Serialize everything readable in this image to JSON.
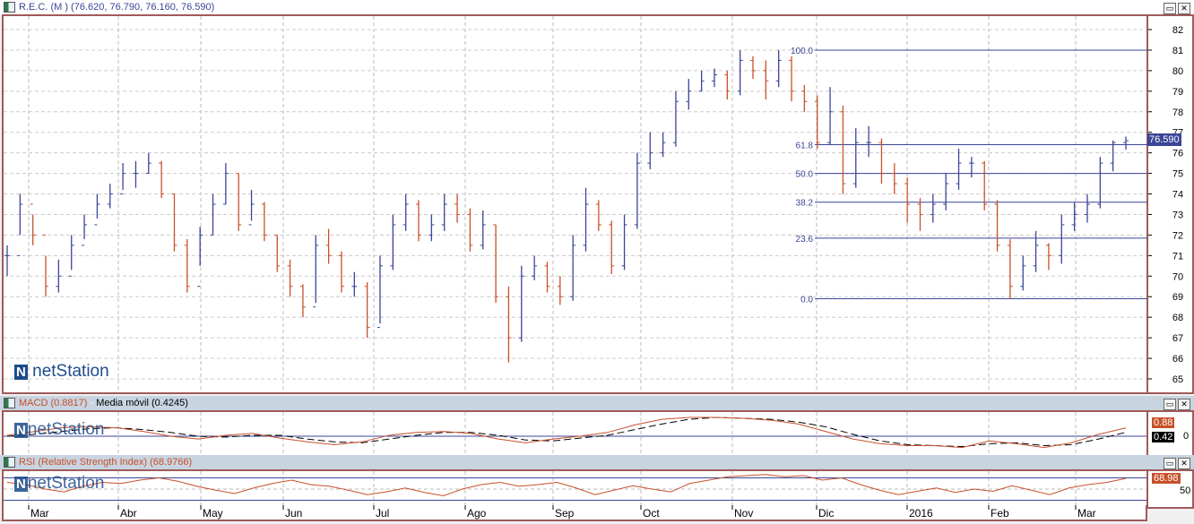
{
  "main": {
    "title": "R.E.C. (M ) (76.620, 76.790, 76.160, 76.590)",
    "last_price_label": "76.590",
    "watermark": "netStation"
  },
  "macd": {
    "title": "MACD (0.8817)",
    "sep": " - ",
    "ma_title": "Media móvil (0.4245)",
    "macd_badge": "0.88",
    "signal_badge": "0.42",
    "zero_label": "0"
  },
  "rsi": {
    "title": "RSI (Relative Strength Index) (68.9766)",
    "badge": "68.98",
    "mid_label": "50"
  },
  "colors": {
    "up": "#3a4596",
    "down": "#c8502a",
    "fib": "#3a4596",
    "frame": "#a05a5a"
  },
  "chart_data": {
    "type": "ohlc",
    "y_ticks": [
      82,
      81,
      80,
      79,
      78,
      77,
      76,
      75,
      74,
      73,
      72,
      71,
      70,
      69,
      68,
      67,
      66,
      65
    ],
    "ylim": [
      64.6,
      82.5
    ],
    "x_labels": [
      "Mar",
      "Abr",
      "May",
      "Jun",
      "Jul",
      "Ago",
      "Sep",
      "Oct",
      "Nov",
      "Dic",
      "2016",
      "Feb",
      "Mar"
    ],
    "fibonacci": [
      {
        "label": "100.0",
        "price": 81.0
      },
      {
        "label": "61.8",
        "price": 76.4
      },
      {
        "label": "50.0",
        "price": 75.0
      },
      {
        "label": "38.2",
        "price": 73.6
      },
      {
        "label": "23.6",
        "price": 71.85
      },
      {
        "label": "0.0",
        "price": 68.9
      }
    ],
    "bars_hlc": [
      [
        71.5,
        70,
        71
      ],
      [
        74,
        72,
        73.5
      ],
      [
        73,
        71.5,
        72
      ],
      [
        71,
        69,
        69.5
      ],
      [
        70.8,
        69.2,
        70
      ],
      [
        72,
        70.3,
        71.5
      ],
      [
        73,
        71.8,
        72.5
      ],
      [
        74,
        72.8,
        73.5
      ],
      [
        74.5,
        73.3,
        74
      ],
      [
        75.5,
        74.2,
        75
      ],
      [
        75.6,
        74.3,
        75
      ],
      [
        76,
        75,
        75.5
      ],
      [
        75.6,
        73.8,
        74
      ],
      [
        74,
        71.2,
        71.5
      ],
      [
        71.8,
        69.2,
        69.5
      ],
      [
        72.4,
        70.5,
        72
      ],
      [
        74,
        72,
        73.5
      ],
      [
        75.5,
        73.5,
        75
      ],
      [
        75,
        72.2,
        72.5
      ],
      [
        74.2,
        72.7,
        73.5
      ],
      [
        73.6,
        71.7,
        72
      ],
      [
        72,
        70.2,
        70.5
      ],
      [
        70.8,
        69,
        69.5
      ],
      [
        69.6,
        68,
        68.5
      ],
      [
        72,
        68.7,
        71.5
      ],
      [
        72.3,
        70.6,
        71
      ],
      [
        71.2,
        69.2,
        69.5
      ],
      [
        70.2,
        69,
        69.5
      ],
      [
        69.7,
        67,
        67.5
      ],
      [
        71,
        67.7,
        70.5
      ],
      [
        73,
        70.3,
        72.5
      ],
      [
        74,
        72.2,
        73.5
      ],
      [
        73.7,
        71.7,
        72
      ],
      [
        73,
        71.7,
        72.5
      ],
      [
        74,
        72.2,
        73.5
      ],
      [
        74,
        72.6,
        73
      ],
      [
        73.3,
        71.2,
        71.5
      ],
      [
        73.2,
        71.3,
        72.5
      ],
      [
        72.5,
        68.7,
        69
      ],
      [
        69.5,
        65.8,
        67
      ],
      [
        70.5,
        66.8,
        70
      ],
      [
        71,
        69.8,
        70.5
      ],
      [
        70.7,
        69.2,
        69.5
      ],
      [
        70,
        68.6,
        69
      ],
      [
        72,
        68.8,
        71.5
      ],
      [
        74.3,
        71.2,
        73.5
      ],
      [
        73.7,
        72.2,
        72.5
      ],
      [
        72.7,
        70.1,
        70.5
      ],
      [
        73,
        70.3,
        72.5
      ],
      [
        76,
        72.3,
        75.5
      ],
      [
        77,
        75.2,
        76
      ],
      [
        77,
        75.8,
        76.5
      ],
      [
        79,
        76.3,
        78.5
      ],
      [
        79.6,
        78.1,
        79
      ],
      [
        80,
        79,
        79.5
      ],
      [
        80.1,
        79.2,
        79.8
      ],
      [
        80,
        78.6,
        79
      ],
      [
        81,
        78.8,
        80.5
      ],
      [
        80.7,
        79.6,
        80
      ],
      [
        80.5,
        78.6,
        79.5
      ],
      [
        81,
        79.2,
        80.5
      ],
      [
        80.7,
        78.5,
        79
      ],
      [
        79.3,
        78,
        78.5
      ],
      [
        78.8,
        76.2,
        76.5
      ],
      [
        79.2,
        76.4,
        78
      ],
      [
        78.3,
        74,
        74.5
      ],
      [
        77.2,
        74.3,
        76.5
      ],
      [
        77.3,
        75.8,
        76.5
      ],
      [
        76.7,
        74.5,
        75
      ],
      [
        75.5,
        74,
        74.5
      ],
      [
        74.8,
        72.6,
        73.5
      ],
      [
        73.8,
        72.2,
        73
      ],
      [
        74,
        72.6,
        73.5
      ],
      [
        75,
        73.2,
        74.5
      ],
      [
        76.2,
        74.2,
        75.5
      ],
      [
        75.8,
        74.8,
        75.5
      ],
      [
        75.6,
        73.2,
        73.5
      ],
      [
        73.7,
        71.2,
        71.5
      ],
      [
        71.8,
        68.9,
        69.5
      ],
      [
        71,
        69.3,
        70.5
      ],
      [
        72.2,
        70.2,
        71.5
      ],
      [
        71.6,
        70.3,
        71
      ],
      [
        73,
        70.6,
        72.5
      ],
      [
        73.6,
        72.2,
        73
      ],
      [
        74,
        72.6,
        73.5
      ],
      [
        75.8,
        73.3,
        75.5
      ],
      [
        76.6,
        75.1,
        76.5
      ],
      [
        76.79,
        76.16,
        76.59
      ]
    ],
    "macd": [
      0.1,
      0.5,
      0.9,
      1.0,
      0.9,
      0.5,
      0.0,
      -0.3,
      0.1,
      0.3,
      -0.2,
      -0.6,
      -0.9,
      -0.6,
      0.1,
      0.4,
      0.5,
      0.3,
      -0.3,
      -0.7,
      -0.3,
      0.0,
      0.4,
      1.2,
      1.8,
      2.0,
      2.0,
      1.9,
      1.7,
      1.3,
      0.5,
      -0.3,
      -0.8,
      -1.0,
      -1.0,
      -1.2,
      -0.5,
      -0.8,
      -1.2,
      -0.7,
      0.2,
      0.88
    ],
    "signal": [
      0.0,
      0.2,
      0.5,
      0.8,
      0.9,
      0.7,
      0.4,
      0.0,
      -0.1,
      0.1,
      0.1,
      -0.3,
      -0.6,
      -0.7,
      -0.3,
      0.1,
      0.4,
      0.4,
      0.1,
      -0.4,
      -0.5,
      -0.2,
      0.1,
      0.7,
      1.3,
      1.8,
      2.0,
      1.9,
      1.8,
      1.5,
      1.0,
      0.2,
      -0.5,
      -0.9,
      -1.0,
      -1.1,
      -0.8,
      -0.7,
      -1.0,
      -0.9,
      -0.3,
      0.42
    ],
    "rsi": [
      62,
      58,
      50,
      45,
      55,
      62,
      60,
      66,
      70,
      64,
      55,
      48,
      42,
      52,
      60,
      66,
      58,
      55,
      48,
      40,
      45,
      52,
      44,
      38,
      50,
      58,
      62,
      55,
      58,
      62,
      52,
      40,
      48,
      56,
      50,
      45,
      60,
      66,
      72,
      74,
      76,
      72,
      74,
      66,
      70,
      58,
      48,
      40,
      46,
      52,
      44,
      50,
      46,
      56,
      48,
      40,
      52,
      58,
      62,
      68.98
    ],
    "rsi_levels": [
      70,
      50,
      30
    ]
  }
}
